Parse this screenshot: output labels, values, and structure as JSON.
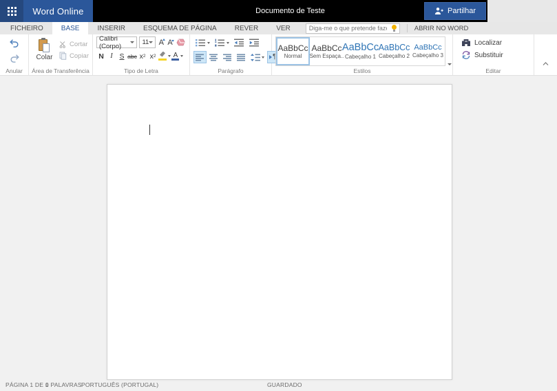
{
  "topbar": {
    "brand": "Word Online",
    "title": "Documento de Teste",
    "share_label": "Partilhar"
  },
  "tabbar": {
    "tabs": [
      {
        "label": "FICHEIRO"
      },
      {
        "label": "BASE"
      },
      {
        "label": "INSERIR"
      },
      {
        "label": "ESQUEMA DE PÁGINA"
      },
      {
        "label": "REVER"
      },
      {
        "label": "VER"
      }
    ],
    "active_tab": "BASE",
    "tellme_placeholder": "Diga-me o que pretende fazer",
    "open_in_word": "ABRIR NO WORD"
  },
  "ribbon": {
    "undo_group": {
      "label": "Anular"
    },
    "clipboard_group": {
      "label": "Área de Transferência",
      "paste": "Colar",
      "cut": "Cortar",
      "copy": "Copiar"
    },
    "font_group": {
      "label": "Tipo de Letra",
      "font_name": "Calibri (Corpo)",
      "font_size": "11",
      "bold": "N",
      "italic": "I",
      "underline": "S",
      "strikethrough": "abc",
      "subscript_base": "x",
      "subscript_mark": "2",
      "superscript_base": "x",
      "superscript_mark": "2",
      "font_color_letter": "A"
    },
    "paragraph_group": {
      "label": "Parágrafo"
    },
    "styles_group": {
      "label": "Estilos",
      "selected_style": "Normal",
      "styles": [
        {
          "sample": "AaBbCc",
          "name": "Normal"
        },
        {
          "sample": "AaBbCc",
          "name": "Sem Espaça.."
        },
        {
          "sample": "AaBbCc",
          "name": "Cabeçalho 1"
        },
        {
          "sample": "AaBbCc",
          "name": "Cabeçalho 2"
        },
        {
          "sample": "AaBbCc",
          "name": "Cabeçalho 3"
        }
      ]
    },
    "edit_group": {
      "label": "Editar",
      "find": "Localizar",
      "replace": "Substituir"
    }
  },
  "statusbar": {
    "page_count": "PÁGINA 1 DE 1",
    "word_count": "0 PALAVRAS",
    "language": "PORTUGUÊS (PORTUGAL)",
    "save_status": "GUARDADO"
  },
  "colors": {
    "accent": "#2b579a",
    "launcher_blue": "#25487e",
    "heading_blue": "#2e74b5",
    "selection_bg": "#cde6f7",
    "selection_border": "#9cc3e5",
    "highlight_yellow": "#f5d327",
    "clipboard_tan": "#d29a4f"
  }
}
